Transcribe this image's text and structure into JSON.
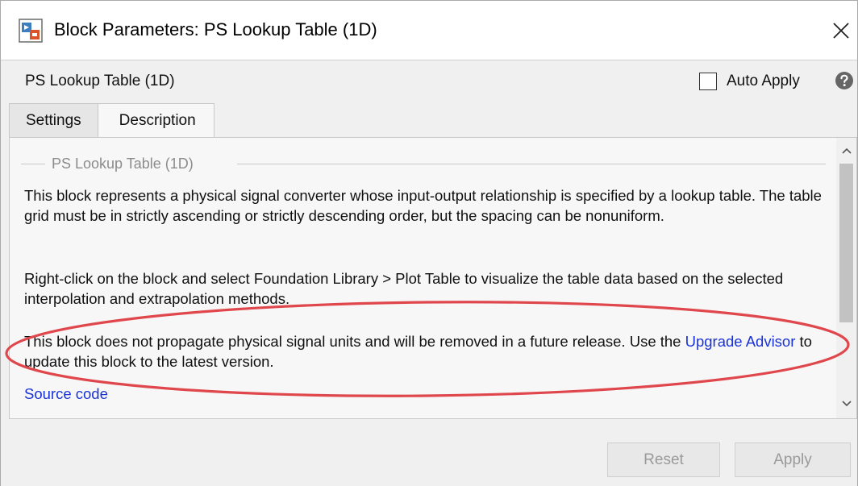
{
  "window": {
    "title": "Block Parameters: PS Lookup Table (1D)"
  },
  "header": {
    "block_name": "PS Lookup Table (1D)",
    "auto_apply_label": "Auto Apply",
    "auto_apply_checked": false
  },
  "tabs": [
    {
      "label": "Settings",
      "active": false
    },
    {
      "label": "Description",
      "active": true
    }
  ],
  "description": {
    "group_title": "PS Lookup Table (1D)",
    "paragraph1": "This block represents a physical signal converter whose input-output relationship is specified by a lookup table. The table grid must be in strictly ascending or strictly descending order, but the spacing can be nonuniform.",
    "paragraph2": "Right-click on the block and select Foundation Library > Plot Table to visualize the table data based on the selected interpolation and extrapolation methods.",
    "paragraph3_before_link": "This block does not propagate physical signal units and will be removed in a future release. Use the ",
    "paragraph3_link": "Upgrade Advisor",
    "paragraph3_after_link": " to update this block to the latest version.",
    "source_code_link": "Source code"
  },
  "footer": {
    "reset_label": "Reset",
    "apply_label": "Apply"
  },
  "colors": {
    "link": "#1a33d6",
    "annotation": "#e0474c"
  }
}
